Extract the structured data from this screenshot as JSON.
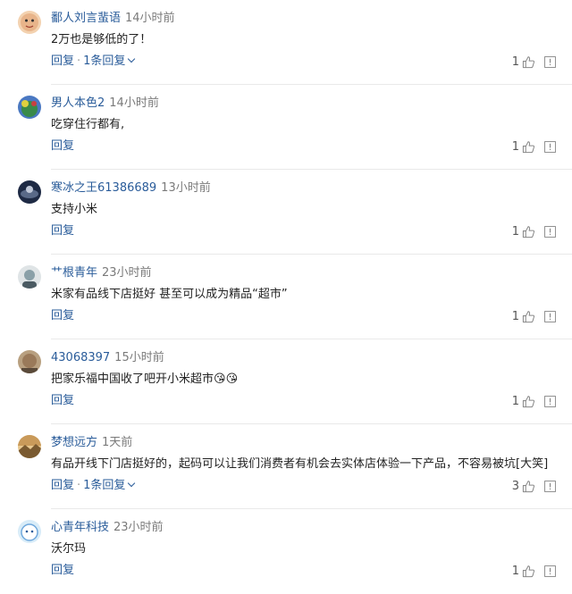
{
  "colors": {
    "username": "#2a5c9a",
    "timestamp": "#7a7a7a",
    "text": "#222222",
    "divider": "#e9e9e9"
  },
  "comments": [
    {
      "username": "鄱人刘言蜚语",
      "time": "14小时前",
      "text": "2万也是够低的了！",
      "reply_label": "回复",
      "replies_label": "1条回复",
      "likes": "1",
      "avatar_color": "#e8b48a"
    },
    {
      "username": "男人本色2",
      "time": "14小时前",
      "text": "吃穿住行都有,",
      "reply_label": "回复",
      "replies_label": "",
      "likes": "1",
      "avatar_color": "#3a8a4a"
    },
    {
      "username": "寒冰之王61386689",
      "time": "13小时前",
      "text": "支持小米",
      "reply_label": "回复",
      "replies_label": "",
      "likes": "1",
      "avatar_color": "#1e2a44"
    },
    {
      "username": "艹根青年",
      "time": "23小时前",
      "text": "米家有品线下店挺好 甚至可以成为精品“超市”",
      "reply_label": "回复",
      "replies_label": "",
      "likes": "1",
      "avatar_color": "#8aa0a8"
    },
    {
      "username": "43068397",
      "time": "15小时前",
      "text": "把家乐福中国收了吧开小米超市",
      "emoji": "😘😘",
      "reply_label": "回复",
      "replies_label": "",
      "likes": "1",
      "avatar_color": "#9a7a5a"
    },
    {
      "username": "梦想远方",
      "time": "1天前",
      "text": "有品开线下门店挺好的，起码可以让我们消费者有机会去实体店体验一下产品，不容易被坑[大笑]",
      "reply_label": "回复",
      "replies_label": "1条回复",
      "likes": "3",
      "avatar_color": "#c99a5a"
    },
    {
      "username": "心青年科技",
      "time": "23小时前",
      "text": "沃尔玛",
      "reply_label": "回复",
      "replies_label": "",
      "likes": "1",
      "avatar_color": "#6fa8dc"
    }
  ]
}
